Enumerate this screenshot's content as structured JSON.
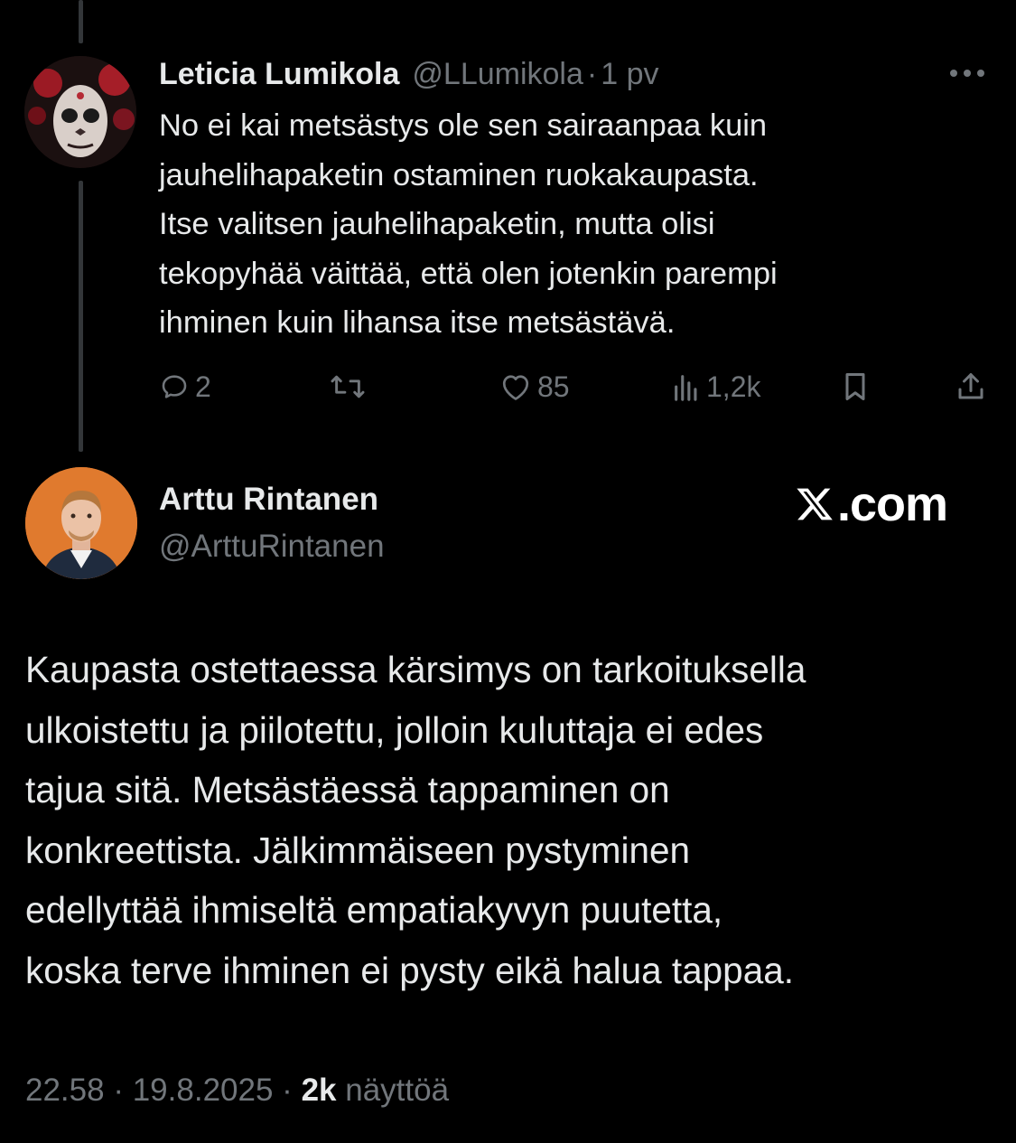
{
  "reply_to": {
    "name": "Leticia Lumikola",
    "handle": "@LLumikola",
    "separator": "·",
    "time": "1 pv",
    "text_lines": [
      "No ei kai metsästys ole sen sairaanpaa kuin",
      "jauhelihapaketin ostaminen ruokakaupasta.",
      "Itse valitsen jauhelihapaketin, mutta olisi",
      "tekopyhää väittää, että olen jotenkin parempi",
      "ihminen kuin lihansa itse metsästävä."
    ],
    "actions": {
      "replies": "2",
      "likes": "85",
      "views": "1,2k"
    }
  },
  "main_tweet": {
    "name": "Arttu Rintanen",
    "handle": "@ArttuRintanen",
    "watermark": ".com",
    "text_lines": [
      "Kaupasta ostettaessa kärsimys on tarkoituksella",
      "ulkoistettu ja piilotettu, jolloin kuluttaja ei edes",
      "tajua sitä. Metsästäessä tappaminen on",
      "konkreettista. Jälkimmäiseen pystyminen",
      "edellyttää ihmiseltä empatiakyvyn puutetta,",
      "koska terve ihminen ei pysty eikä halua tappaa."
    ],
    "meta": {
      "time": "22.58",
      "sep1": "·",
      "date": "19.8.2025",
      "sep2": "·",
      "views_count": "2k",
      "views_label": "näyttöä"
    }
  },
  "colors": {
    "background": "#000000",
    "text": "#e7e9ea",
    "muted": "#71767b",
    "thread_line": "#333639",
    "avatar2_bg": "#e07a2e"
  },
  "icons": [
    "more-icon",
    "reply-icon",
    "retweet-icon",
    "like-icon",
    "views-icon",
    "bookmark-icon",
    "share-icon",
    "x-logo-icon"
  ]
}
